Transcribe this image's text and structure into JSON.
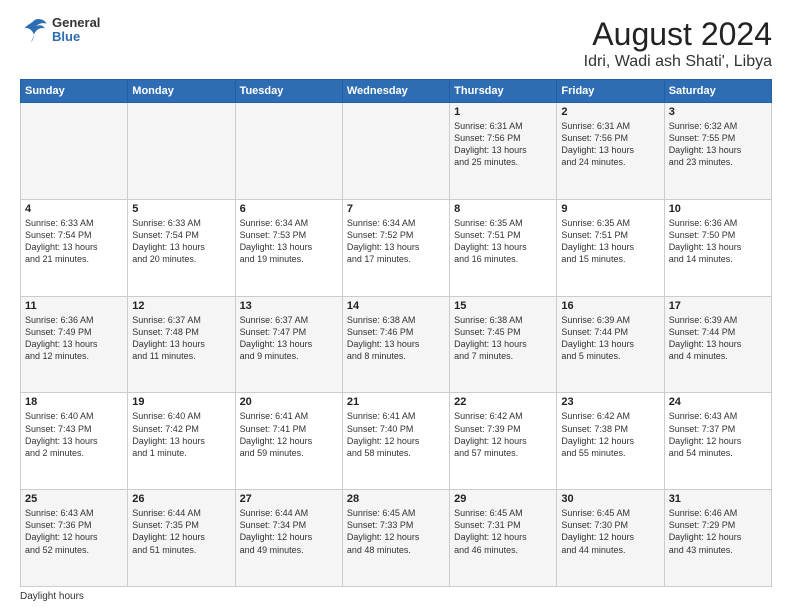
{
  "logo": {
    "general": "General",
    "blue": "Blue"
  },
  "title": "August 2024",
  "subtitle": "Idri, Wadi ash Shati', Libya",
  "days_header": [
    "Sunday",
    "Monday",
    "Tuesday",
    "Wednesday",
    "Thursday",
    "Friday",
    "Saturday"
  ],
  "weeks": [
    [
      {
        "day": "",
        "detail": ""
      },
      {
        "day": "",
        "detail": ""
      },
      {
        "day": "",
        "detail": ""
      },
      {
        "day": "",
        "detail": ""
      },
      {
        "day": "1",
        "detail": "Sunrise: 6:31 AM\nSunset: 7:56 PM\nDaylight: 13 hours\nand 25 minutes."
      },
      {
        "day": "2",
        "detail": "Sunrise: 6:31 AM\nSunset: 7:56 PM\nDaylight: 13 hours\nand 24 minutes."
      },
      {
        "day": "3",
        "detail": "Sunrise: 6:32 AM\nSunset: 7:55 PM\nDaylight: 13 hours\nand 23 minutes."
      }
    ],
    [
      {
        "day": "4",
        "detail": "Sunrise: 6:33 AM\nSunset: 7:54 PM\nDaylight: 13 hours\nand 21 minutes."
      },
      {
        "day": "5",
        "detail": "Sunrise: 6:33 AM\nSunset: 7:54 PM\nDaylight: 13 hours\nand 20 minutes."
      },
      {
        "day": "6",
        "detail": "Sunrise: 6:34 AM\nSunset: 7:53 PM\nDaylight: 13 hours\nand 19 minutes."
      },
      {
        "day": "7",
        "detail": "Sunrise: 6:34 AM\nSunset: 7:52 PM\nDaylight: 13 hours\nand 17 minutes."
      },
      {
        "day": "8",
        "detail": "Sunrise: 6:35 AM\nSunset: 7:51 PM\nDaylight: 13 hours\nand 16 minutes."
      },
      {
        "day": "9",
        "detail": "Sunrise: 6:35 AM\nSunset: 7:51 PM\nDaylight: 13 hours\nand 15 minutes."
      },
      {
        "day": "10",
        "detail": "Sunrise: 6:36 AM\nSunset: 7:50 PM\nDaylight: 13 hours\nand 14 minutes."
      }
    ],
    [
      {
        "day": "11",
        "detail": "Sunrise: 6:36 AM\nSunset: 7:49 PM\nDaylight: 13 hours\nand 12 minutes."
      },
      {
        "day": "12",
        "detail": "Sunrise: 6:37 AM\nSunset: 7:48 PM\nDaylight: 13 hours\nand 11 minutes."
      },
      {
        "day": "13",
        "detail": "Sunrise: 6:37 AM\nSunset: 7:47 PM\nDaylight: 13 hours\nand 9 minutes."
      },
      {
        "day": "14",
        "detail": "Sunrise: 6:38 AM\nSunset: 7:46 PM\nDaylight: 13 hours\nand 8 minutes."
      },
      {
        "day": "15",
        "detail": "Sunrise: 6:38 AM\nSunset: 7:45 PM\nDaylight: 13 hours\nand 7 minutes."
      },
      {
        "day": "16",
        "detail": "Sunrise: 6:39 AM\nSunset: 7:44 PM\nDaylight: 13 hours\nand 5 minutes."
      },
      {
        "day": "17",
        "detail": "Sunrise: 6:39 AM\nSunset: 7:44 PM\nDaylight: 13 hours\nand 4 minutes."
      }
    ],
    [
      {
        "day": "18",
        "detail": "Sunrise: 6:40 AM\nSunset: 7:43 PM\nDaylight: 13 hours\nand 2 minutes."
      },
      {
        "day": "19",
        "detail": "Sunrise: 6:40 AM\nSunset: 7:42 PM\nDaylight: 13 hours\nand 1 minute."
      },
      {
        "day": "20",
        "detail": "Sunrise: 6:41 AM\nSunset: 7:41 PM\nDaylight: 12 hours\nand 59 minutes."
      },
      {
        "day": "21",
        "detail": "Sunrise: 6:41 AM\nSunset: 7:40 PM\nDaylight: 12 hours\nand 58 minutes."
      },
      {
        "day": "22",
        "detail": "Sunrise: 6:42 AM\nSunset: 7:39 PM\nDaylight: 12 hours\nand 57 minutes."
      },
      {
        "day": "23",
        "detail": "Sunrise: 6:42 AM\nSunset: 7:38 PM\nDaylight: 12 hours\nand 55 minutes."
      },
      {
        "day": "24",
        "detail": "Sunrise: 6:43 AM\nSunset: 7:37 PM\nDaylight: 12 hours\nand 54 minutes."
      }
    ],
    [
      {
        "day": "25",
        "detail": "Sunrise: 6:43 AM\nSunset: 7:36 PM\nDaylight: 12 hours\nand 52 minutes."
      },
      {
        "day": "26",
        "detail": "Sunrise: 6:44 AM\nSunset: 7:35 PM\nDaylight: 12 hours\nand 51 minutes."
      },
      {
        "day": "27",
        "detail": "Sunrise: 6:44 AM\nSunset: 7:34 PM\nDaylight: 12 hours\nand 49 minutes."
      },
      {
        "day": "28",
        "detail": "Sunrise: 6:45 AM\nSunset: 7:33 PM\nDaylight: 12 hours\nand 48 minutes."
      },
      {
        "day": "29",
        "detail": "Sunrise: 6:45 AM\nSunset: 7:31 PM\nDaylight: 12 hours\nand 46 minutes."
      },
      {
        "day": "30",
        "detail": "Sunrise: 6:45 AM\nSunset: 7:30 PM\nDaylight: 12 hours\nand 44 minutes."
      },
      {
        "day": "31",
        "detail": "Sunrise: 6:46 AM\nSunset: 7:29 PM\nDaylight: 12 hours\nand 43 minutes."
      }
    ]
  ],
  "footer": {
    "daylight_hours": "Daylight hours"
  }
}
